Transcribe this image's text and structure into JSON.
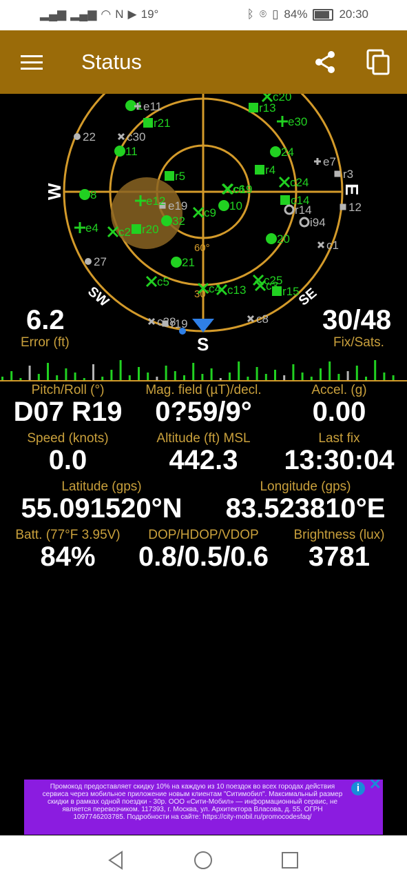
{
  "status_bar": {
    "left_number": "19°",
    "battery": "84%",
    "time": "20:30"
  },
  "toolbar": {
    "title": "Status"
  },
  "sky": {
    "compass": [
      "W",
      "E",
      "S",
      "SW",
      "SE"
    ],
    "elevation_labels": [
      "60°",
      "30°"
    ],
    "satellites": [
      "1",
      "e11",
      "r13",
      "c20",
      "e30",
      "22",
      "c30",
      "r21",
      "11",
      "24",
      "e7",
      "r3",
      "r5",
      "r4",
      "c24",
      "8",
      "c6",
      "10",
      "c14",
      "E",
      "12",
      "e19",
      "c9",
      "e12",
      "r20",
      "32",
      "c2",
      "e4",
      "r14",
      "c1",
      "i94",
      "60°",
      "20",
      "27",
      "21",
      "c5",
      "c25",
      "c3",
      "r15",
      "c13",
      "30°",
      "c28",
      "r19",
      "c8",
      "c4",
      "c19"
    ],
    "colors": {
      "ring": "#d39a2a",
      "in_fix": "#21d121",
      "not_in_fix": "#b5b5b5"
    }
  },
  "overlay": {
    "error_value": "6.2",
    "error_label": "Error (ft)",
    "fix_value": "30/48",
    "fix_label": "Fix/Sats."
  },
  "stats": [
    {
      "label": "Pitch/Roll (°)",
      "value": "D07 R19"
    },
    {
      "label": "Mag. field (µT)/decl.",
      "value": "0?59/9°"
    },
    {
      "label": "Accel. (g)",
      "value": "0.00"
    },
    {
      "label": "Speed (knots)",
      "value": "0.0"
    },
    {
      "label": "Altitude (ft) MSL",
      "value": "442.3"
    },
    {
      "label": "Last fix",
      "value": "13:30:04"
    },
    {
      "label": "Latitude (gps)",
      "value": "55.091520°N"
    },
    {
      "label": "Longitude (gps)",
      "value": "83.523810°E"
    },
    {
      "label": "Batt. (77°F 3.95V)",
      "value": "84%"
    },
    {
      "label": "DOP/HDOP/VDOP",
      "value": "0.8/0.5/0.6"
    },
    {
      "label": "Brightness (lux)",
      "value": "3781"
    }
  ],
  "ad": {
    "text": "Промокод предоставляет скидку 10% на каждую из 10 поездок во всех городах действия сервиса через мобильное приложение новым клиентам \"Ситимобил\". Максимальный размер скидки в рамках одной поездки - 30р. ООО «Сити-Мобил» — информационный сервис, не является перевозчиком. 117393, г. Москва, ул. Архитектора Власова, д. 55. ОГРН 1097746203785. Подробности на сайте: https://city-mobil.ru/promocodesfaq/",
    "info": "i",
    "close": "✕"
  }
}
